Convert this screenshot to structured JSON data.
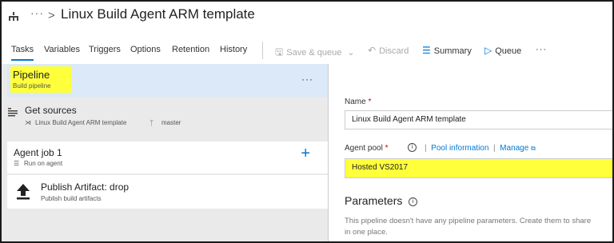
{
  "header": {
    "more": "···",
    "chevron": ">",
    "title": "Linux Build Agent ARM template"
  },
  "toolbar": {
    "tabs": [
      "Tasks",
      "Variables",
      "Triggers",
      "Options",
      "Retention",
      "History"
    ],
    "active_tab": "Tasks",
    "save_queue": "Save & queue",
    "discard": "Discard",
    "summary": "Summary",
    "queue": "Queue",
    "more": "···"
  },
  "pipeline": {
    "title": "Pipeline",
    "subtitle": "Build pipeline",
    "more": "···"
  },
  "get_sources": {
    "title": "Get sources",
    "repo": "Linux Build Agent ARM template",
    "branch": "master"
  },
  "agent_job": {
    "title": "Agent job 1",
    "subtitle": "Run on agent",
    "add": "+"
  },
  "task": {
    "title": "Publish Artifact: drop",
    "subtitle": "Publish build artifacts"
  },
  "details": {
    "name_label": "Name",
    "name_value": "Linux Build Agent ARM template",
    "pool_label": "Agent pool",
    "pool_info_link": "Pool information",
    "manage_link": "Manage",
    "pool_value": "Hosted VS2017",
    "params_heading": "Parameters",
    "params_text_1": "This pipeline doesn't have any pipeline parameters. Create them to share",
    "params_text_2": "in one place."
  },
  "colors": {
    "accent": "#0078d4",
    "highlight": "#ffff3b",
    "selected_row": "#dbe9f8"
  }
}
